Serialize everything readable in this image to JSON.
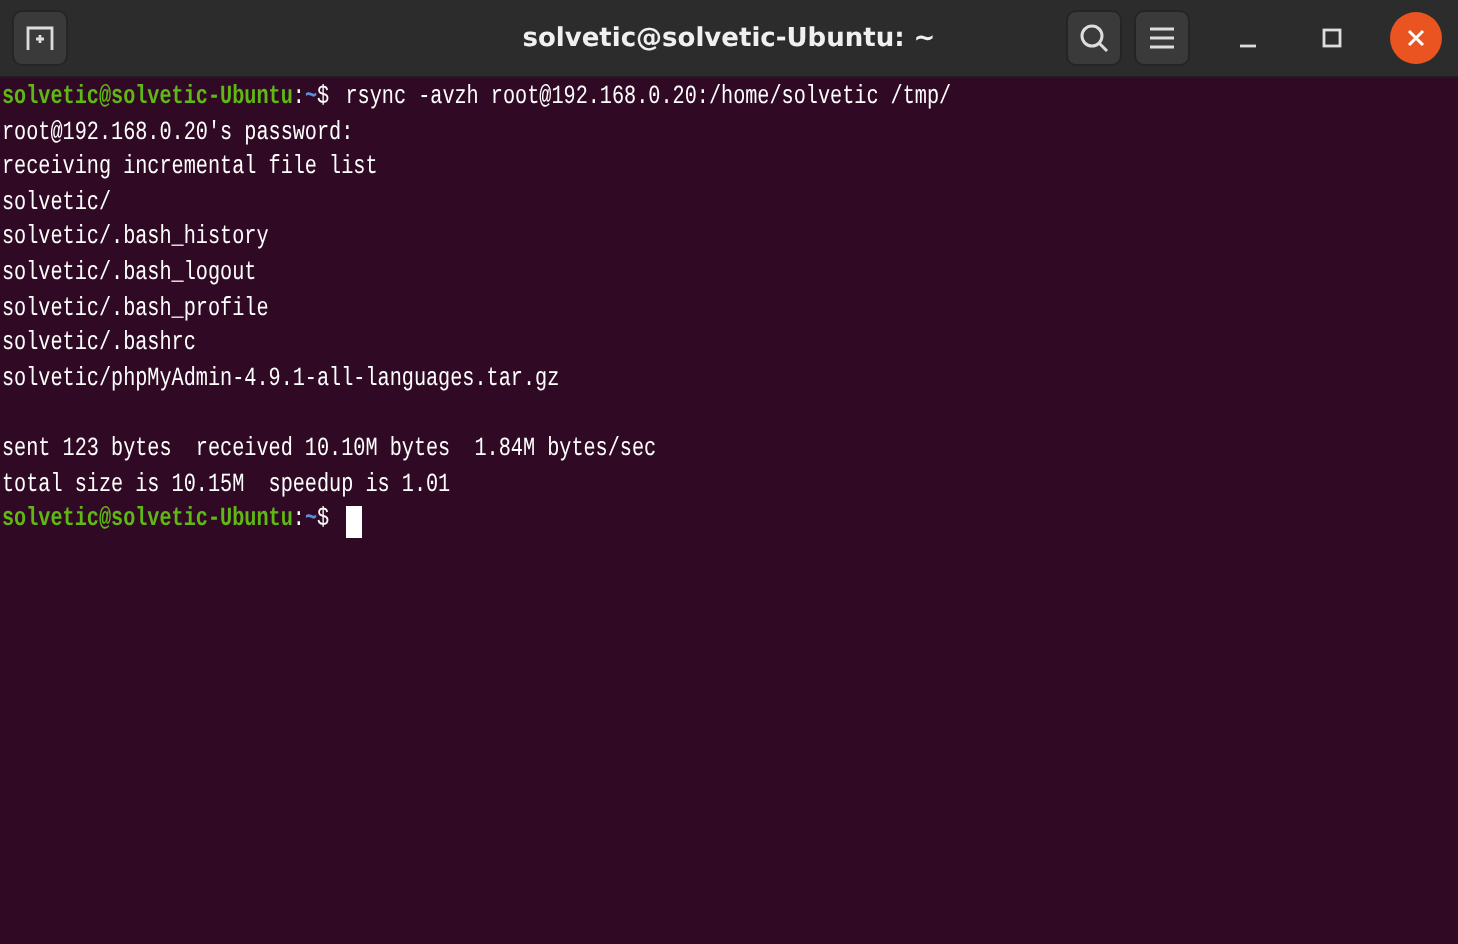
{
  "window": {
    "title": "solvetic@solvetic-Ubuntu: ~"
  },
  "terminal": {
    "lines": [
      {
        "kind": "prompt",
        "user": "solvetic@solvetic-Ubuntu",
        "sep": ":",
        "path": "~",
        "symbol": "$",
        "command": "rsync -avzh root@192.168.0.20:/home/solvetic /tmp/"
      },
      {
        "kind": "output",
        "text": "root@192.168.0.20's password:"
      },
      {
        "kind": "output",
        "text": "receiving incremental file list"
      },
      {
        "kind": "output",
        "text": "solvetic/"
      },
      {
        "kind": "output",
        "text": "solvetic/.bash_history"
      },
      {
        "kind": "output",
        "text": "solvetic/.bash_logout"
      },
      {
        "kind": "output",
        "text": "solvetic/.bash_profile"
      },
      {
        "kind": "output",
        "text": "solvetic/.bashrc"
      },
      {
        "kind": "output",
        "text": "solvetic/phpMyAdmin-4.9.1-all-languages.tar.gz"
      },
      {
        "kind": "blank"
      },
      {
        "kind": "output",
        "text": "sent 123 bytes  received 10.10M bytes  1.84M bytes/sec"
      },
      {
        "kind": "output",
        "text": "total size is 10.15M  speedup is 1.01"
      },
      {
        "kind": "prompt",
        "user": "solvetic@solvetic-Ubuntu",
        "sep": ":",
        "path": "~",
        "symbol": "$",
        "cursor": true
      }
    ]
  }
}
